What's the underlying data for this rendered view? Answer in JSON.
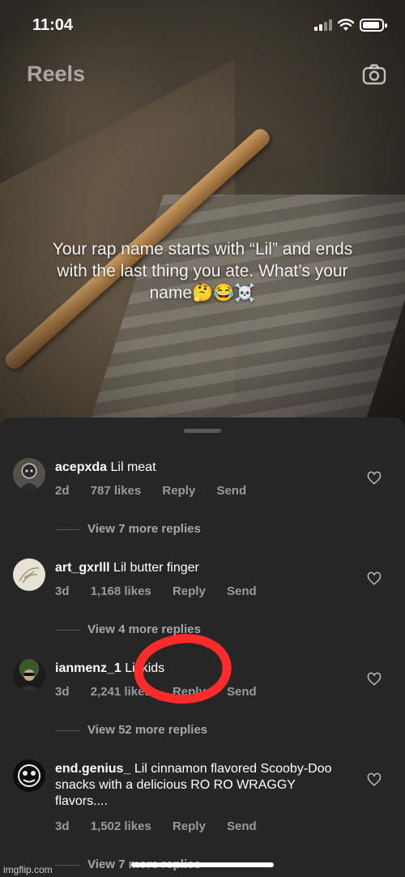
{
  "status_bar": {
    "time": "11:04"
  },
  "header": {
    "title": "Reels"
  },
  "video": {
    "caption": "Your rap name starts with “Lil” and ends with the last thing you ate. What’s your name🤔😂☠️"
  },
  "comments": [
    {
      "username": "acepxda",
      "text": "Lil meat",
      "age": "2d",
      "likes": "787 likes",
      "reply_label": "Reply",
      "send_label": "Send",
      "view_replies": "View 7 more replies"
    },
    {
      "username": "art_gxrlll",
      "text": "Lil butter finger",
      "age": "3d",
      "likes": "1,168 likes",
      "reply_label": "Reply",
      "send_label": "Send",
      "view_replies": "View 4 more replies"
    },
    {
      "username": "ianmenz_1",
      "text": "Lil kids",
      "age": "3d",
      "likes": "2,241 likes",
      "reply_label": "Reply",
      "send_label": "Send",
      "view_replies": "View 52 more replies"
    },
    {
      "username": "end.genius_",
      "text": "Lil cinnamon flavored Scooby-Doo snacks with a delicious RO RO WRAGGY flavors....",
      "age": "3d",
      "likes": "1,502 likes",
      "reply_label": "Reply",
      "send_label": "Send",
      "view_replies": "View 7 more replies"
    }
  ],
  "watermark": "imgflip.com",
  "icons": {
    "camera": "camera-icon",
    "heart": "heart-outline-icon",
    "signal": "cellular-signal-icon",
    "wifi": "wifi-icon",
    "battery": "battery-icon"
  },
  "colors": {
    "sheet_bg": "#262626",
    "marker": "#ff2a2a",
    "meta_text": "#9a9a9a"
  }
}
